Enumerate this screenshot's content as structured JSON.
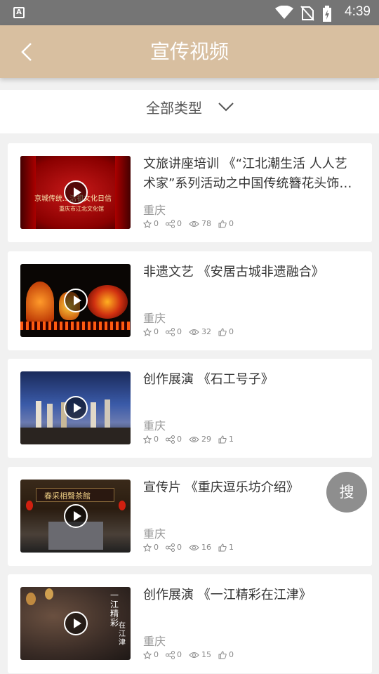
{
  "status_bar": {
    "time": "4:39",
    "app_icon_letter": "A"
  },
  "nav": {
    "title": "宣传视频",
    "back_icon": "chevron-left-icon"
  },
  "filter": {
    "label": "全部类型",
    "icon": "chevron-down-icon"
  },
  "search_fab": {
    "label": "搜"
  },
  "colors": {
    "nav_bg": "#d8bfa0",
    "fab_bg": "#8e8e8e"
  },
  "videos": [
    {
      "title": "文旅讲座培训 《“江北潮生活 人人艺术家”系列活动之中国传统簪花头饰…",
      "city": "重庆",
      "favorites": "0",
      "shares": "0",
      "views": "78",
      "likes": "0"
    },
    {
      "title": "非遗文艺 《安居古城非遗融合》",
      "city": "重庆",
      "favorites": "0",
      "shares": "0",
      "views": "32",
      "likes": "0"
    },
    {
      "title": "创作展演 《石工号子》",
      "city": "重庆",
      "favorites": "0",
      "shares": "0",
      "views": "29",
      "likes": "1"
    },
    {
      "title": "宣传片 《重庆逗乐坊介绍》",
      "city": "重庆",
      "favorites": "0",
      "shares": "0",
      "views": "16",
      "likes": "1"
    },
    {
      "title": "创作展演 《一江精彩在江津》",
      "city": "重庆",
      "favorites": "0",
      "shares": "0",
      "views": "15",
      "likes": "0"
    }
  ],
  "thumb_text": {
    "t1_line1": "京城传统…活祖文化日信",
    "t1_line2": "重庆市江北文化馆",
    "t4_sign": "春采相聲茶館",
    "t5_big": "一江精彩",
    "t5_side": "在江津"
  }
}
